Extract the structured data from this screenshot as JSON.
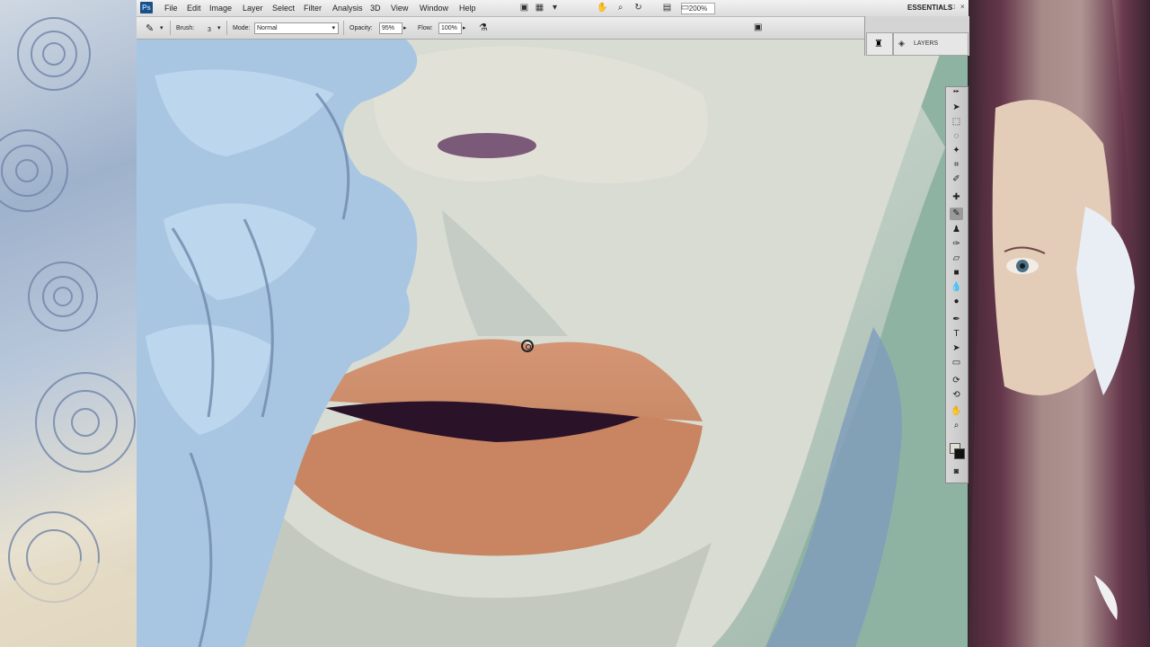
{
  "app": {
    "logo": "Ps"
  },
  "menubar": {
    "items": [
      "File",
      "Edit",
      "Image",
      "Layer",
      "Select",
      "Filter",
      "Analysis",
      "3D",
      "View",
      "Window",
      "Help"
    ],
    "zoom": "200%",
    "workspace": "ESSENTIALS",
    "window_controls": [
      "–",
      "□",
      "×"
    ]
  },
  "options": {
    "brush_label": "Brush:",
    "brush_size": "3",
    "mode_label": "Mode:",
    "mode_value": "Normal",
    "opacity_label": "Opacity:",
    "opacity_value": "95%",
    "flow_label": "Flow:",
    "flow_value": "100%"
  },
  "panels": {
    "layers_tab": "LAYERS"
  },
  "icons": {
    "hand": "hand-icon",
    "zoom": "zoom-icon",
    "rotate": "rotate-view-icon",
    "arrange": "arrange-documents-icon",
    "screen": "screen-mode-icon",
    "airbrush": "airbrush-icon",
    "tablet": "tablet-pressure-icon"
  },
  "colors": {
    "foreground": "#111111",
    "background": "#e0ddd3",
    "ps_blue": "#1b4f86"
  }
}
